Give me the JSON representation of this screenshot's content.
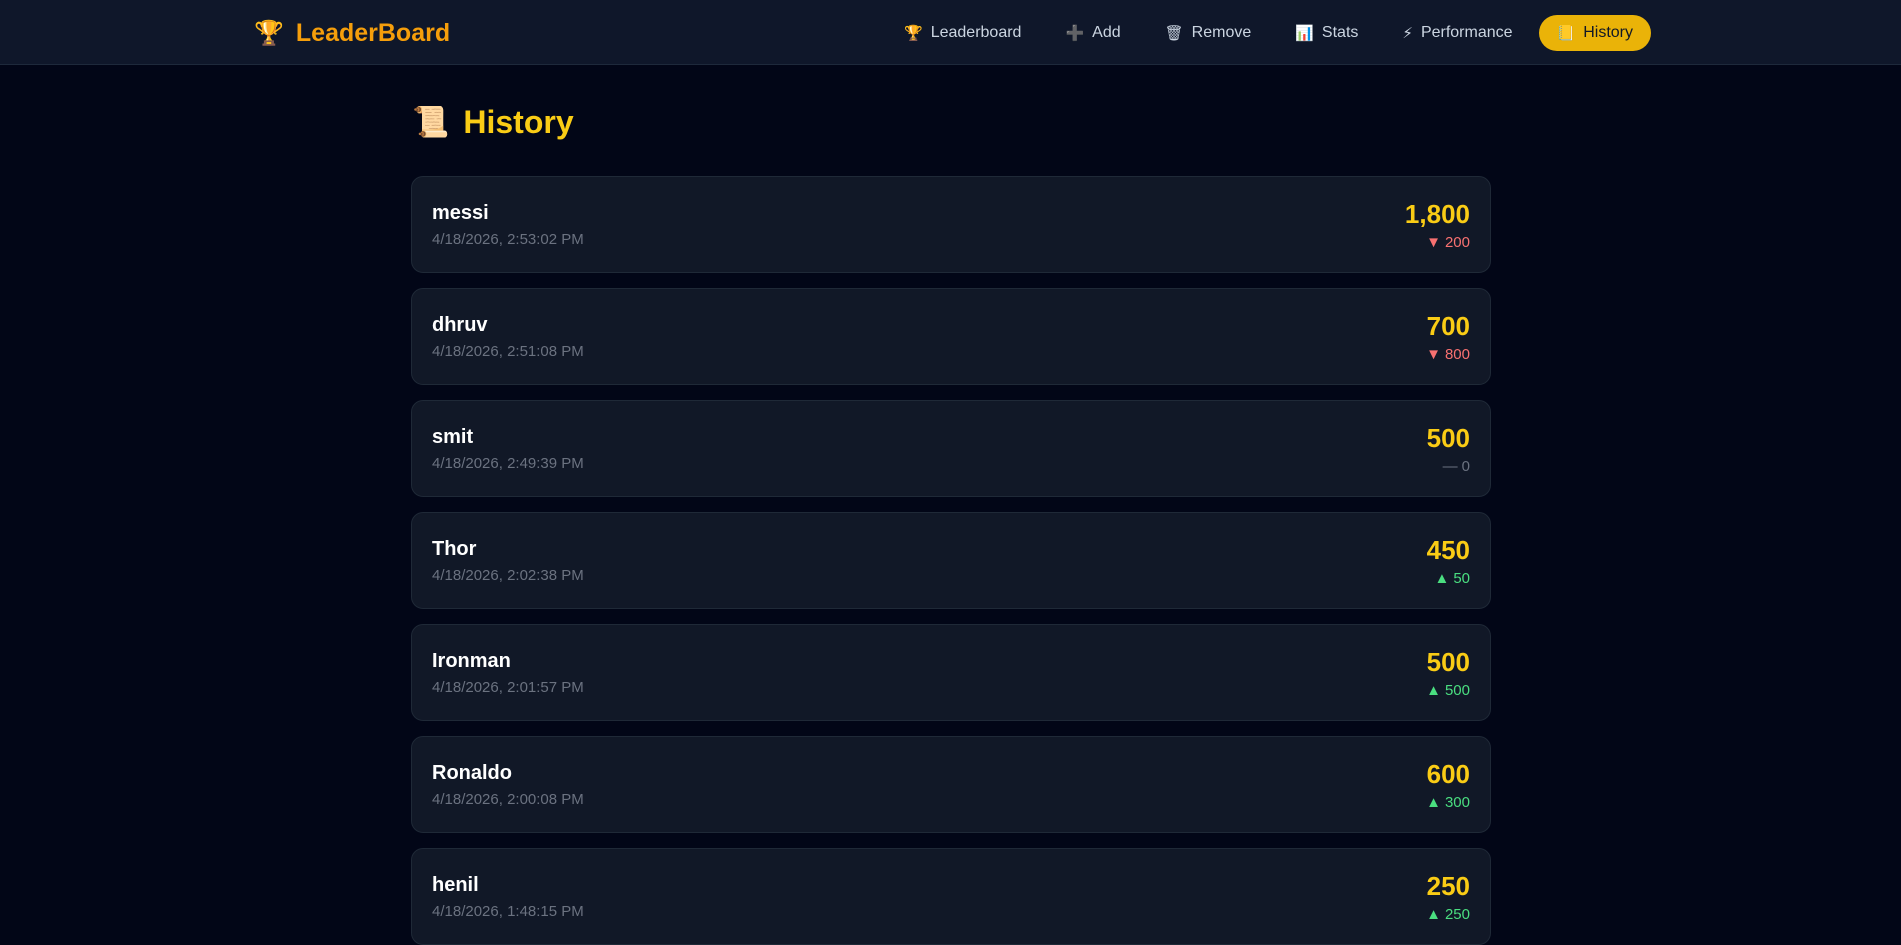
{
  "brand": {
    "icon": "trophy-icon",
    "name": "LeaderBoard"
  },
  "nav": [
    {
      "label": "Leaderboard",
      "icon_glyph": "🏆",
      "icon": "trophy-icon",
      "active": false
    },
    {
      "label": "Add",
      "icon_glyph": "➕",
      "icon": "plus-icon",
      "active": false
    },
    {
      "label": "Remove",
      "icon_glyph": "🗑",
      "icon": "trash-icon",
      "active": false
    },
    {
      "label": "Stats",
      "icon_glyph": "📊",
      "icon": "chart-icon",
      "active": false
    },
    {
      "label": "Performance",
      "icon_glyph": "⚡",
      "icon": "lightning-icon",
      "active": false
    },
    {
      "label": "History",
      "icon_glyph": "📒",
      "icon": "notebook-icon",
      "active": true
    }
  ],
  "page": {
    "title": "History",
    "icon_glyph": "📜",
    "icon": "scroll-icon"
  },
  "history": [
    {
      "name": "messi",
      "time": "4/18/2026, 2:53:02 PM",
      "score": "1,800",
      "direction": "down",
      "change": "200"
    },
    {
      "name": "dhruv",
      "time": "4/18/2026, 2:51:08 PM",
      "score": "700",
      "direction": "down",
      "change": "800"
    },
    {
      "name": "smit",
      "time": "4/18/2026, 2:49:39 PM",
      "score": "500",
      "direction": "flat",
      "change": "0"
    },
    {
      "name": "Thor",
      "time": "4/18/2026, 2:02:38 PM",
      "score": "450",
      "direction": "up",
      "change": "50"
    },
    {
      "name": "Ironman",
      "time": "4/18/2026, 2:01:57 PM",
      "score": "500",
      "direction": "up",
      "change": "500"
    },
    {
      "name": "Ronaldo",
      "time": "4/18/2026, 2:00:08 PM",
      "score": "600",
      "direction": "up",
      "change": "300"
    },
    {
      "name": "henil",
      "time": "4/18/2026, 1:48:15 PM",
      "score": "250",
      "direction": "up",
      "change": "250"
    }
  ],
  "colors": {
    "accent": "#facc15",
    "brand": "#f59e0b",
    "down": "#f87171",
    "up": "#4ade80",
    "flat": "#6b7280"
  }
}
